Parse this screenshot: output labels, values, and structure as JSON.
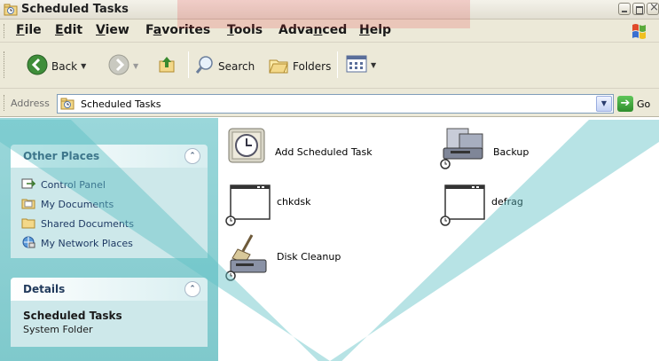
{
  "window": {
    "title": "Scheduled Tasks"
  },
  "menu": {
    "items": [
      {
        "label": "File",
        "accel": "F",
        "rest": "ile"
      },
      {
        "label": "Edit",
        "accel": "E",
        "rest": "dit"
      },
      {
        "label": "View",
        "accel": "V",
        "rest": "iew"
      },
      {
        "label": "Favorites",
        "pre": "F",
        "accel": "a",
        "rest": "vorites"
      },
      {
        "label": "Tools",
        "accel": "T",
        "rest": "ools"
      },
      {
        "label": "Advanced",
        "pre": "Adva",
        "accel": "n",
        "rest": "ced"
      },
      {
        "label": "Help",
        "accel": "H",
        "rest": "elp"
      }
    ]
  },
  "toolbar": {
    "back_label": "Back",
    "search_label": "Search",
    "folders_label": "Folders"
  },
  "address": {
    "label": "Address",
    "value": "Scheduled Tasks",
    "go_label": "Go"
  },
  "other_places": {
    "title": "Other Places",
    "links": [
      {
        "label": "Control Panel"
      },
      {
        "label": "My Documents"
      },
      {
        "label": "Shared Documents"
      },
      {
        "label": "My Network Places"
      }
    ]
  },
  "details": {
    "title": "Details",
    "name": "Scheduled Tasks",
    "type": "System Folder"
  },
  "items": [
    {
      "label": "Add Scheduled Task"
    },
    {
      "label": "Backup"
    },
    {
      "label": "chkdsk"
    },
    {
      "label": "defrag"
    },
    {
      "label": "Disk Cleanup"
    }
  ],
  "colors": {
    "accent": "#e2262f",
    "pane": "#7fc9cc"
  }
}
